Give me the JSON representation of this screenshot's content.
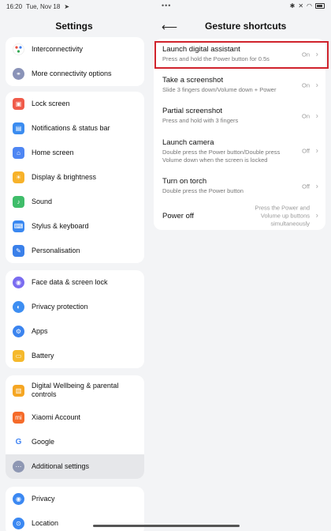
{
  "status": {
    "time": "16:20",
    "date": "Tue, Nov 18"
  },
  "left": {
    "title": "Settings",
    "groups": [
      {
        "items": [
          {
            "label": "Interconnectivity",
            "icon": "interconnectivity-icon",
            "color": "#f5f5f5"
          },
          {
            "label": "More connectivity options",
            "icon": "connectivity-icon",
            "color": "#8a93b8"
          }
        ]
      },
      {
        "items": [
          {
            "label": "Lock screen",
            "icon": "lock-icon",
            "color": "#f05b4a"
          },
          {
            "label": "Notifications & status bar",
            "icon": "notification-icon",
            "color": "#3b8cf0"
          },
          {
            "label": "Home screen",
            "icon": "home-icon",
            "color": "#4e86f3"
          },
          {
            "label": "Display & brightness",
            "icon": "brightness-icon",
            "color": "#f7b22a"
          },
          {
            "label": "Sound",
            "icon": "sound-icon",
            "color": "#3fbd6a"
          },
          {
            "label": "Stylus & keyboard",
            "icon": "keyboard-icon",
            "color": "#3a88f1"
          },
          {
            "label": "Personalisation",
            "icon": "personalisation-icon",
            "color": "#3a80ea"
          }
        ]
      },
      {
        "items": [
          {
            "label": "Face data & screen lock",
            "icon": "face-icon",
            "color": "#7a6cf0"
          },
          {
            "label": "Privacy protection",
            "icon": "privacy-protection-icon",
            "color": "#3d8ef2"
          },
          {
            "label": "Apps",
            "icon": "apps-icon",
            "color": "#3b84ef"
          },
          {
            "label": "Battery",
            "icon": "battery-icon",
            "color": "#f5b92c"
          }
        ]
      },
      {
        "items": [
          {
            "label": "Digital Wellbeing & parental controls",
            "icon": "wellbeing-icon",
            "color": "#f5a623"
          },
          {
            "label": "Xiaomi Account",
            "icon": "xiaomi-icon",
            "color": "#f56b2a"
          },
          {
            "label": "Google",
            "icon": "google-icon",
            "color": "#ffffff"
          },
          {
            "label": "Additional settings",
            "icon": "more-icon",
            "color": "#8e97b3"
          }
        ]
      },
      {
        "items": [
          {
            "label": "Privacy",
            "icon": "privacy-icon",
            "color": "#3b88f2"
          },
          {
            "label": "Location",
            "icon": "location-icon",
            "color": "#3b88f2"
          }
        ]
      }
    ]
  },
  "right": {
    "title": "Gesture shortcuts",
    "items": [
      {
        "title": "Launch digital assistant",
        "subtitle": "Press and hold the Power button for 0.5s",
        "value": "On"
      },
      {
        "title": "Take a screenshot",
        "subtitle": "Slide 3 fingers down/Volume down + Power",
        "value": "On"
      },
      {
        "title": "Partial screenshot",
        "subtitle": "Press and hold with 3 fingers",
        "value": "On"
      },
      {
        "title": "Launch camera",
        "subtitle": "Double press the Power button/Double press Volume down when the screen is locked",
        "value": "Off"
      },
      {
        "title": "Turn on torch",
        "subtitle": "Double press the Power button",
        "value": "Off"
      },
      {
        "title": "Power off",
        "subtitle": "",
        "value": "Press the Power and Volume up buttons simultaneously"
      }
    ]
  }
}
